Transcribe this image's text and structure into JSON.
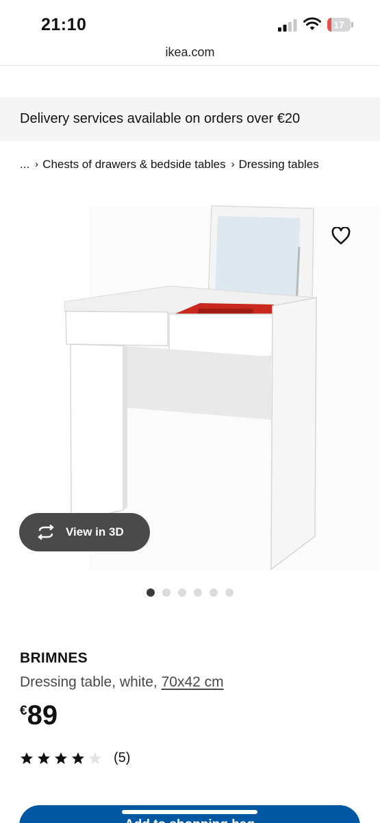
{
  "status_bar": {
    "time": "21:10",
    "battery": "17",
    "battery_level": 0.17,
    "battery_color": "#e5524f",
    "icons": [
      "signal-icon",
      "wifi-icon",
      "battery-icon"
    ]
  },
  "browser": {
    "url": "ikea.com"
  },
  "banner": {
    "delivery": "Delivery services available on orders over €20"
  },
  "breadcrumb": {
    "items": [
      "...",
      "Chests of drawers & bedside tables",
      "Dressing tables"
    ],
    "separator_icon": "chevron-right-icon"
  },
  "gallery": {
    "view_3d_label": "View in 3D",
    "view_3d_icon": "rotate-3d-icon",
    "favorite_icon": "heart-outline-icon",
    "slides": 6,
    "active_slide": 1
  },
  "product": {
    "name": "BRIMNES",
    "description": "Dressing table, white, ",
    "size": "70x42 cm",
    "currency": "€",
    "price": "89",
    "rating": 4,
    "rating_max": 5,
    "review_count": "(5)"
  },
  "actions": {
    "add_to_bag": "Add to shopping bag"
  },
  "colors": {
    "accent": "#0058a3",
    "banner_bg": "#f5f5f5",
    "view_3d_bg": "#4a4a4a",
    "drawer_interior": "#c8281e"
  }
}
